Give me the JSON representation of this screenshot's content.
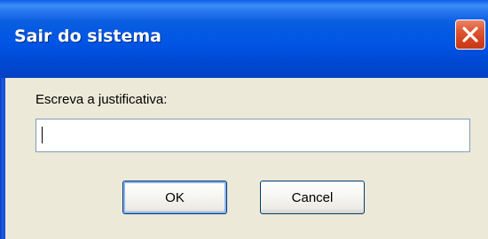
{
  "dialog": {
    "title": "Sair do sistema",
    "close_icon": "close-icon",
    "prompt_label": "Escreva a justificativa:",
    "input_value": "",
    "ok_label": "OK",
    "cancel_label": "Cancel"
  },
  "colors": {
    "titlebar": "#0055e5",
    "close_button": "#d4421e",
    "dialog_background": "#ece9d8",
    "input_border": "#7f9db9",
    "button_border": "#003c74"
  }
}
